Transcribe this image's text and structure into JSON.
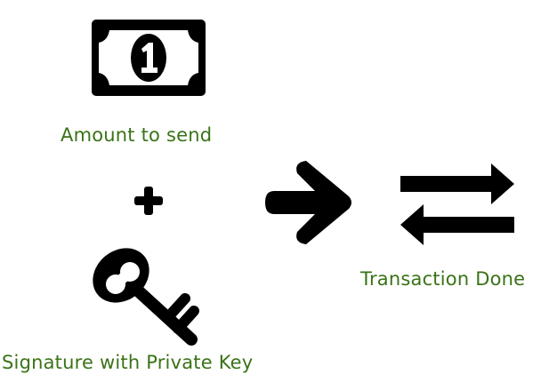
{
  "labels": {
    "amount": "Amount to send",
    "signature": "Signature with Private Key",
    "transaction": "Transaction Done"
  },
  "icons": {
    "bill": "money-bill-icon",
    "plus": "plus-icon",
    "key": "key-icon",
    "arrow": "arrow-right-icon",
    "exchange": "exchange-arrows-icon"
  },
  "bill_digit": "1",
  "colors": {
    "label": "#3a7317",
    "icon": "#000000"
  }
}
